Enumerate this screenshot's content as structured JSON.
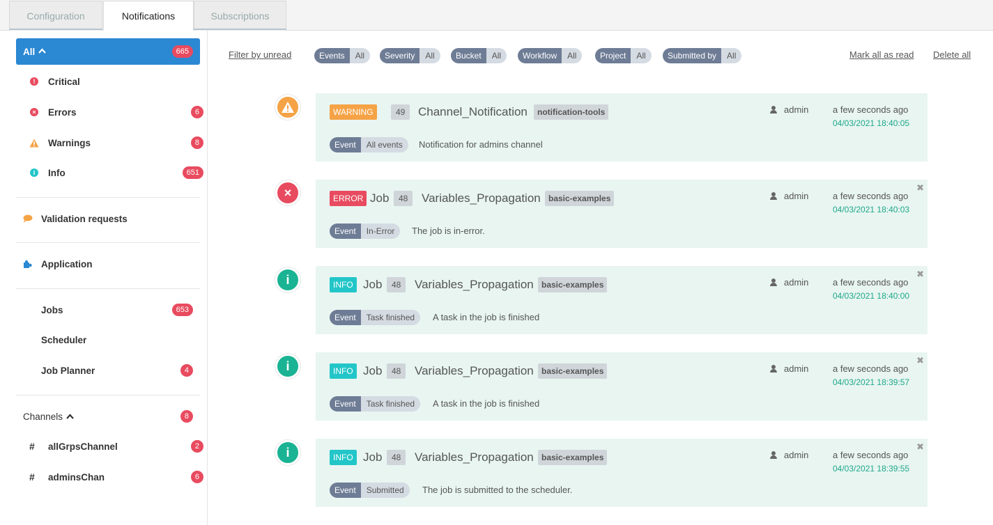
{
  "tabs": [
    "Configuration",
    "Notifications",
    "Subscriptions"
  ],
  "sidebar": {
    "all": {
      "label": "All",
      "count": "665"
    },
    "severity": [
      {
        "label": "Critical",
        "count": ""
      },
      {
        "label": "Errors",
        "count": "6"
      },
      {
        "label": "Warnings",
        "count": "8"
      },
      {
        "label": "Info",
        "count": "651"
      }
    ],
    "validation": {
      "label": "Validation requests"
    },
    "application": {
      "label": "Application"
    },
    "apps": [
      {
        "label": "Jobs",
        "count": "653"
      },
      {
        "label": "Scheduler",
        "count": ""
      },
      {
        "label": "Job Planner",
        "count": "4"
      }
    ],
    "channels": {
      "label": "Channels",
      "count": "8"
    },
    "channel_items": [
      {
        "label": "allGrpsChannel",
        "count": "2"
      },
      {
        "label": "adminsChan",
        "count": "6"
      }
    ]
  },
  "filters": {
    "filter_unread": "Filter by unread",
    "chips": [
      {
        "key": "Events",
        "value": "All"
      },
      {
        "key": "Severity",
        "value": "All"
      },
      {
        "key": "Bucket",
        "value": "All"
      },
      {
        "key": "Workflow",
        "value": "All"
      },
      {
        "key": "Project",
        "value": "All"
      },
      {
        "key": "Submitted by",
        "value": "All"
      }
    ],
    "mark_all_read": "Mark all as read",
    "delete_all": "Delete all"
  },
  "colors": {
    "warning": "#f5a346",
    "error": "#e84b5f",
    "info": "#1ab394",
    "info_badge": "#23c6c8",
    "accent": "#2b88d3"
  },
  "notifications": [
    {
      "severity": "WARNING",
      "kind": "",
      "id": "49",
      "title": "Channel_Notification",
      "bucket": "notification-tools",
      "user": "admin",
      "ago": "a few seconds ago",
      "time": "04/03/2021 18:40:05",
      "event_key": "Event",
      "event_value": "All events",
      "message": "Notification for admins channel",
      "icon": "warning-icon",
      "closable": false
    },
    {
      "severity": "ERROR",
      "kind": "Job",
      "id": "48",
      "title": "Variables_Propagation",
      "bucket": "basic-examples",
      "user": "admin",
      "ago": "a few seconds ago",
      "time": "04/03/2021 18:40:03",
      "event_key": "Event",
      "event_value": "In-Error",
      "message": "The job is in-error.",
      "icon": "error-icon",
      "closable": true
    },
    {
      "severity": "INFO",
      "kind": "Job",
      "id": "48",
      "title": "Variables_Propagation",
      "bucket": "basic-examples",
      "user": "admin",
      "ago": "a few seconds ago",
      "time": "04/03/2021 18:40:00",
      "event_key": "Event",
      "event_value": "Task finished",
      "message": "A task in the job is finished",
      "icon": "info-icon",
      "closable": true
    },
    {
      "severity": "INFO",
      "kind": "Job",
      "id": "48",
      "title": "Variables_Propagation",
      "bucket": "basic-examples",
      "user": "admin",
      "ago": "a few seconds ago",
      "time": "04/03/2021 18:39:57",
      "event_key": "Event",
      "event_value": "Task finished",
      "message": "A task in the job is finished",
      "icon": "info-icon",
      "closable": true
    },
    {
      "severity": "INFO",
      "kind": "Job",
      "id": "48",
      "title": "Variables_Propagation",
      "bucket": "basic-examples",
      "user": "admin",
      "ago": "a few seconds ago",
      "time": "04/03/2021 18:39:55",
      "event_key": "Event",
      "event_value": "Submitted",
      "message": "The job is submitted to the scheduler.",
      "icon": "info-icon",
      "closable": true
    }
  ]
}
